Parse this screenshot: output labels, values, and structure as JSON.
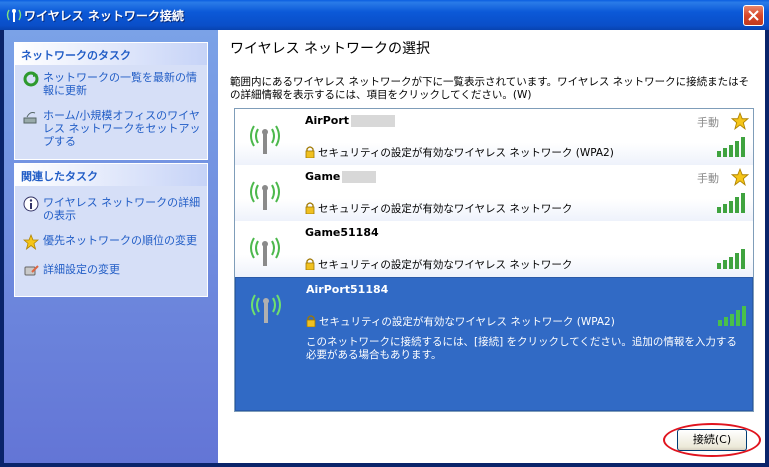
{
  "window": {
    "title": "ワイヤレス ネットワーク接続"
  },
  "tasks_network": {
    "header": "ネットワークのタスク",
    "items": [
      {
        "label": "ネットワークの一覧を最新の情報に更新"
      },
      {
        "label": "ホーム/小規模オフィスのワイヤレス ネットワークをセットアップする"
      }
    ]
  },
  "tasks_related": {
    "header": "関連したタスク",
    "items": [
      {
        "label": "ワイヤレス ネットワークの詳細の表示"
      },
      {
        "label": "優先ネットワークの順位の変更"
      },
      {
        "label": "詳細設定の変更"
      }
    ]
  },
  "main": {
    "heading": "ワイヤレス ネットワークの選択",
    "description": "範囲内にあるワイヤレス ネットワークが下に一覧表示されています。ワイヤレス ネットワークに接続またはその詳細情報を表示するには、項目をクリックしてください。(W)"
  },
  "networks": [
    {
      "ssid": "AirPort",
      "redacted": true,
      "mode": "手動",
      "starred": true,
      "security": "セキュリティの設定が有効なワイヤレス ネットワーク (WPA2)"
    },
    {
      "ssid": "Game",
      "redacted": true,
      "mode": "手動",
      "starred": true,
      "security": "セキュリティの設定が有効なワイヤレス ネットワーク"
    },
    {
      "ssid": "Game51184",
      "redacted": false,
      "mode": "",
      "starred": false,
      "security": "セキュリティの設定が有効なワイヤレス ネットワーク"
    },
    {
      "ssid": "AirPort51184",
      "redacted": false,
      "mode": "",
      "starred": false,
      "security": "セキュリティの設定が有効なワイヤレス ネットワーク (WPA2)",
      "message": "このネットワークに接続するには、[接続] をクリックしてください。追加の情報を入力する必要がある場合もあります。",
      "selected": true
    }
  ],
  "footer": {
    "connect_label": "接続(C)"
  },
  "colors": {
    "selection": "#316ac5",
    "link": "#215dc6",
    "highlight_ring": "#e0141e",
    "signal": "#3fa33f"
  }
}
